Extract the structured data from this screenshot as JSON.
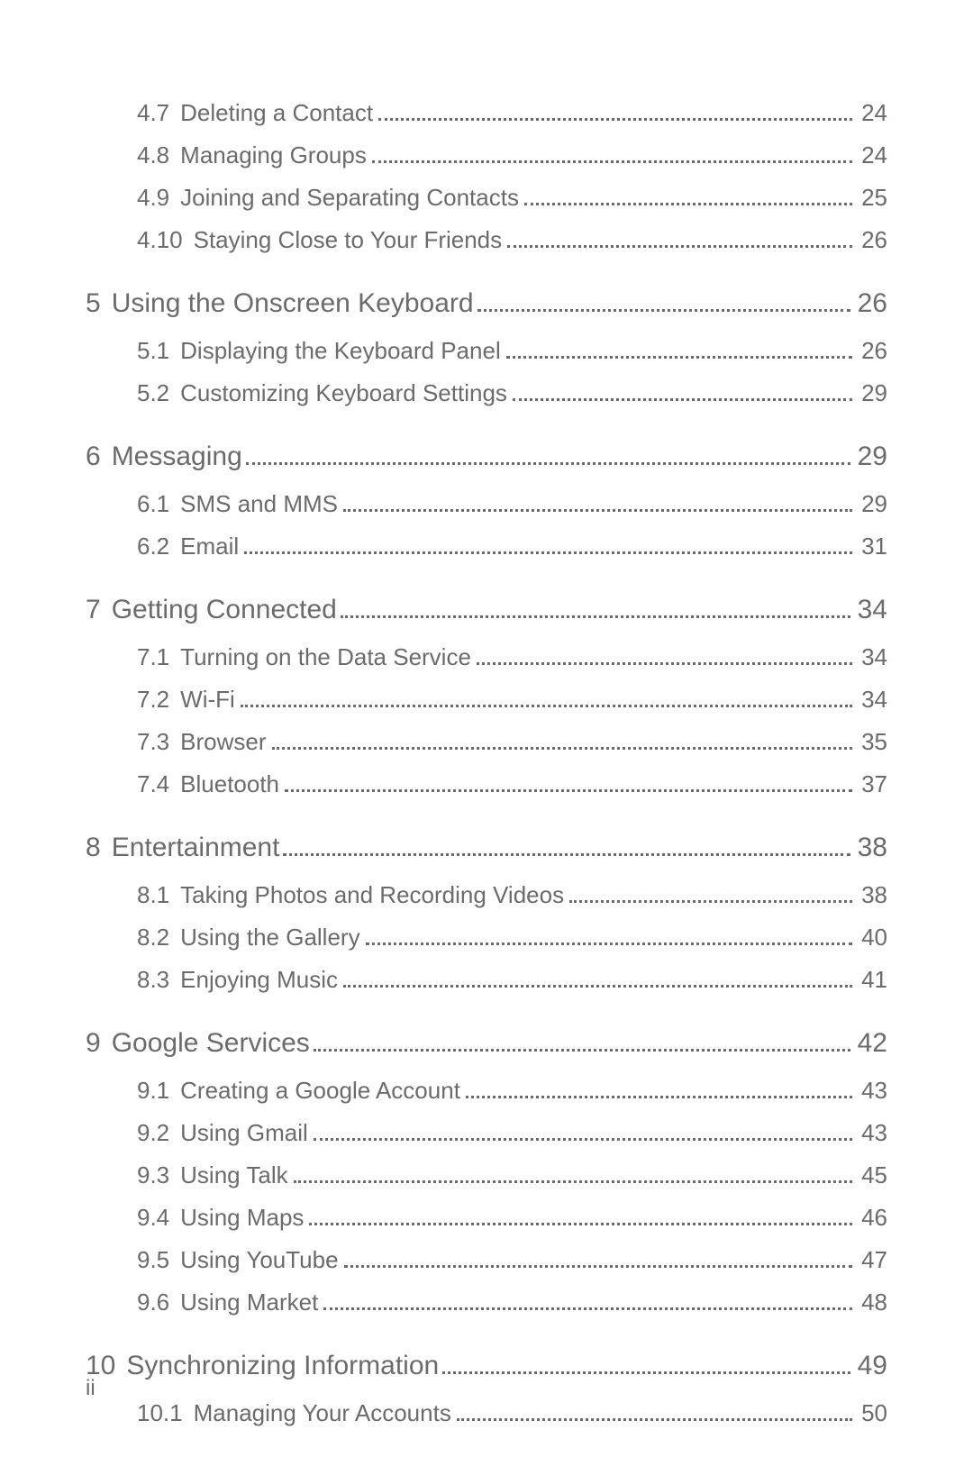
{
  "toc": {
    "initial_subs": [
      {
        "num": "4.7",
        "title": "Deleting a Contact",
        "page": "24"
      },
      {
        "num": "4.8",
        "title": "Managing Groups",
        "page": "24"
      },
      {
        "num": "4.9",
        "title": "Joining and Separating Contacts",
        "page": "25"
      },
      {
        "num": "4.10",
        "title": "Staying Close to Your Friends",
        "page": "26"
      }
    ],
    "chapters": [
      {
        "num": "5",
        "title": "Using the Onscreen Keyboard",
        "page": "26",
        "subs": [
          {
            "num": "5.1",
            "title": "Displaying the Keyboard Panel",
            "page": "26"
          },
          {
            "num": "5.2",
            "title": "Customizing Keyboard Settings",
            "page": "29"
          }
        ]
      },
      {
        "num": "6",
        "title": "Messaging",
        "page": "29",
        "subs": [
          {
            "num": "6.1",
            "title": "SMS and MMS",
            "page": "29"
          },
          {
            "num": "6.2",
            "title": "Email",
            "page": "31"
          }
        ]
      },
      {
        "num": "7",
        "title": "Getting Connected",
        "page": "34",
        "subs": [
          {
            "num": "7.1",
            "title": "Turning on the Data Service",
            "page": "34"
          },
          {
            "num": "7.2",
            "title": "Wi-Fi",
            "page": "34"
          },
          {
            "num": "7.3",
            "title": "Browser",
            "page": "35"
          },
          {
            "num": "7.4",
            "title": "Bluetooth",
            "page": "37"
          }
        ]
      },
      {
        "num": "8",
        "title": "Entertainment",
        "page": "38",
        "subs": [
          {
            "num": "8.1",
            "title": "Taking Photos and Recording Videos",
            "page": "38"
          },
          {
            "num": "8.2",
            "title": "Using the Gallery",
            "page": "40"
          },
          {
            "num": "8.3",
            "title": "Enjoying Music",
            "page": "41"
          }
        ]
      },
      {
        "num": "9",
        "title": "Google Services",
        "page": "42",
        "subs": [
          {
            "num": "9.1",
            "title": "Creating a Google Account",
            "page": "43"
          },
          {
            "num": "9.2",
            "title": "Using Gmail",
            "page": "43"
          },
          {
            "num": "9.3",
            "title": "Using Talk",
            "page": "45"
          },
          {
            "num": "9.4",
            "title": "Using Maps",
            "page": "46"
          },
          {
            "num": "9.5",
            "title": "Using YouTube",
            "page": "47"
          },
          {
            "num": "9.6",
            "title": "Using Market",
            "page": "48"
          }
        ]
      },
      {
        "num": "10",
        "title": "Synchronizing Information",
        "page": "49",
        "subs": [
          {
            "num": "10.1",
            "title": "Managing Your Accounts",
            "page": "50"
          }
        ]
      }
    ]
  },
  "footer": "ii"
}
